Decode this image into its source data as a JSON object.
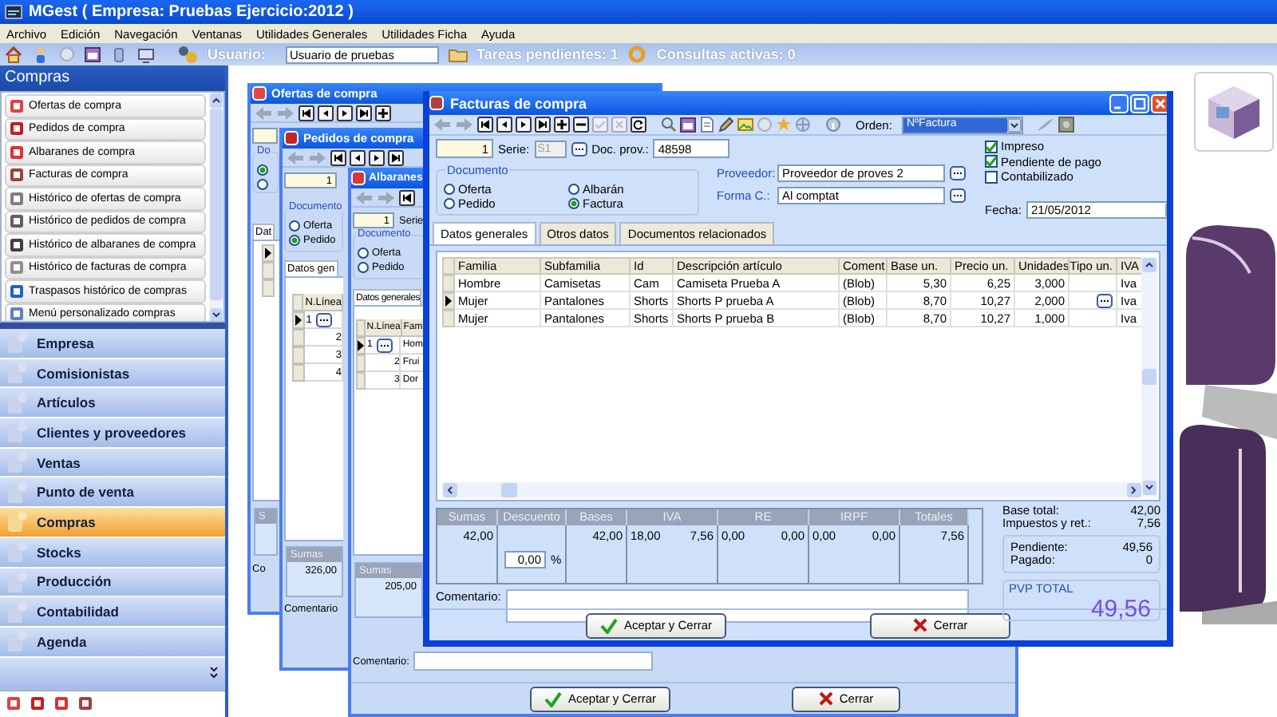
{
  "app": {
    "title": "MGest ( Empresa: Pruebas Ejercicio:2012 )"
  },
  "menu": [
    "Archivo",
    "Edición",
    "Navegación",
    "Ventanas",
    "Utilidades Generales",
    "Utilidades Ficha",
    "Ayuda"
  ],
  "toolbar": {
    "user_label": "Usuario:",
    "user_value": "Usuario de pruebas",
    "tasks": "Tareas pendientes: 1",
    "queries": "Consultas activas: 0"
  },
  "sidebar": {
    "title": "Compras",
    "items": [
      {
        "label": "Ofertas de compra",
        "color": "#e04040"
      },
      {
        "label": "Pedidos de compra",
        "color": "#c02020"
      },
      {
        "label": "Albaranes de compra",
        "color": "#e03030"
      },
      {
        "label": "Facturas de compra",
        "color": "#a04040"
      },
      {
        "label": "Histórico de ofertas de compra",
        "color": "#808080"
      },
      {
        "label": "Histórico de pedidos de compra",
        "color": "#606060"
      },
      {
        "label": "Histórico de albaranes de compra",
        "color": "#404040"
      },
      {
        "label": "Histórico de facturas de compra",
        "color": "#909090"
      },
      {
        "label": "Traspasos histórico de compras",
        "color": "#2060d0"
      },
      {
        "label": "Menú personalizado compras",
        "color": "#6080c0"
      }
    ],
    "sections": [
      {
        "label": "Empresa",
        "selected": false
      },
      {
        "label": "Comisionistas",
        "selected": false
      },
      {
        "label": "Artículos",
        "selected": false
      },
      {
        "label": "Clientes y proveedores",
        "selected": false
      },
      {
        "label": "Ventas",
        "selected": false
      },
      {
        "label": "Punto de venta",
        "selected": false
      },
      {
        "label": "Compras",
        "selected": true
      },
      {
        "label": "Stocks",
        "selected": false
      },
      {
        "label": "Producción",
        "selected": false
      },
      {
        "label": "Contabilidad",
        "selected": false
      },
      {
        "label": "Agenda",
        "selected": false
      }
    ]
  },
  "windows": [
    {
      "title": "Ofertas de compra",
      "doc_title": "Do",
      "options": [
        {
          "selected": true
        },
        {
          "selected": false
        }
      ],
      "tab": "Dat",
      "rows": [
        {
          "selected": true
        },
        {
          "selected": false
        },
        {
          "selected": false
        }
      ],
      "sums_label": "S",
      "comment_label": "Co"
    },
    {
      "title": "Pedidos de compra",
      "number": "1",
      "doc_title": "Documento",
      "options": [
        {
          "label": "Oferta",
          "selected": false
        },
        {
          "label": "Pedido",
          "selected": true
        }
      ],
      "tab": "Datos gen",
      "columns": [
        "N.Línea"
      ],
      "rows": [
        {
          "selected": true,
          "cells": [
            "1"
          ]
        },
        {
          "selected": false,
          "cells": [
            "2"
          ]
        },
        {
          "selected": false,
          "cells": [
            "3"
          ]
        },
        {
          "selected": false,
          "cells": [
            "4"
          ]
        }
      ],
      "sums_label": "Sumas",
      "sums_value": "326,00",
      "comment_label": "Comentario"
    },
    {
      "title": "Albaranes",
      "number": "1",
      "serie": "Serie",
      "doc_title": "Documento",
      "options": [
        {
          "label": "Oferta",
          "selected": false
        },
        {
          "label": "Pedido",
          "selected": false
        }
      ],
      "tab": "Datos generales",
      "columns": [
        "N.Línea",
        "Fam"
      ],
      "rows": [
        {
          "selected": true,
          "cells": [
            "1",
            "Hom"
          ]
        },
        {
          "selected": false,
          "cells": [
            "2",
            "Frui"
          ]
        },
        {
          "selected": false,
          "cells": [
            "3",
            "Dor"
          ]
        }
      ],
      "sums_label": "Sumas",
      "sums_value": "205,00",
      "comment_label": "Comentario:",
      "buttons": [
        {
          "label": "Aceptar y Cerrar",
          "kind": "accept"
        },
        {
          "label": "Cerrar",
          "kind": "cancel"
        }
      ]
    }
  ],
  "invoice": {
    "title": "Facturas de compra",
    "order_label": "Orden:",
    "order_value": "NºFactura",
    "number": "1",
    "serie_label": "Serie:",
    "serie_value": "S1",
    "docprov_label": "Doc. prov.:",
    "docprov_value": "48598",
    "document": {
      "title": "Documento",
      "options": [
        {
          "label": "Oferta",
          "selected": false
        },
        {
          "label": "Albarán",
          "selected": false
        },
        {
          "label": "Pedido",
          "selected": false
        },
        {
          "label": "Factura",
          "selected": true
        }
      ]
    },
    "supplier_label": "Proveedor:",
    "supplier_value": "Proveedor de proves 2",
    "payment_label": "Forma C.:",
    "payment_value": "Al comptat",
    "flags": [
      {
        "label": "Impreso",
        "checked": true
      },
      {
        "label": "Pendiente de pago",
        "checked": true
      },
      {
        "label": "Contabilizado",
        "checked": false
      }
    ],
    "date_label": "Fecha:",
    "date_value": "21/05/2012",
    "tabs": [
      {
        "label": "Datos generales",
        "selected": true
      },
      {
        "label": "Otros datos",
        "selected": false
      },
      {
        "label": "Documentos relacionados",
        "selected": false
      }
    ],
    "table": {
      "columns": [
        "Familia",
        "Subfamilia",
        "Id",
        "Descripción artículo",
        "Coment",
        "Base un.",
        "Precio un.",
        "Unidades",
        "Tipo un.",
        "IVA"
      ],
      "rows": [
        {
          "selected": false,
          "cells": [
            "Hombre",
            "Camisetas",
            "Cam",
            "Camiseta Prueba A",
            "(Blob)",
            "5,30",
            "6,25",
            "3,000",
            "",
            "Iva"
          ]
        },
        {
          "selected": true,
          "cells": [
            "Mujer",
            "Pantalones",
            "Shorts",
            "Shorts P prueba A",
            "(Blob)",
            "8,70",
            "10,27",
            "2,000",
            "",
            "Iva"
          ]
        },
        {
          "selected": false,
          "cells": [
            "Mujer",
            "Pantalones",
            "Shorts",
            "Shorts P prueba B",
            "(Blob)",
            "8,70",
            "10,27",
            "1,000",
            "",
            "Iva"
          ]
        }
      ]
    },
    "totals": {
      "columns": [
        "Sumas",
        "Descuento",
        "Bases",
        "IVA",
        "RE",
        "IRPF",
        "Totales"
      ],
      "sums": "42,00",
      "discount": "0,00",
      "percent": "%",
      "bases": "42,00",
      "iva": [
        "18,00",
        "7,56"
      ],
      "re": [
        "0,00",
        "0,00"
      ],
      "irpf": [
        "0,00",
        "0,00"
      ],
      "total": "7,56"
    },
    "summary": [
      {
        "label": "Base total:",
        "value": "42,00"
      },
      {
        "label": "Impuestos y ret.:",
        "value": "7,56"
      }
    ],
    "balance": [
      {
        "label": "Pendiente:",
        "value": "49,56"
      },
      {
        "label": "Pagado:",
        "value": "0"
      }
    ],
    "pvp": {
      "label": "PVP TOTAL",
      "value": "49,56"
    },
    "comment_label": "Comentario:",
    "buttons": [
      {
        "label": "Aceptar y Cerrar",
        "kind": "accept"
      },
      {
        "label": "Cerrar",
        "kind": "cancel"
      }
    ]
  }
}
